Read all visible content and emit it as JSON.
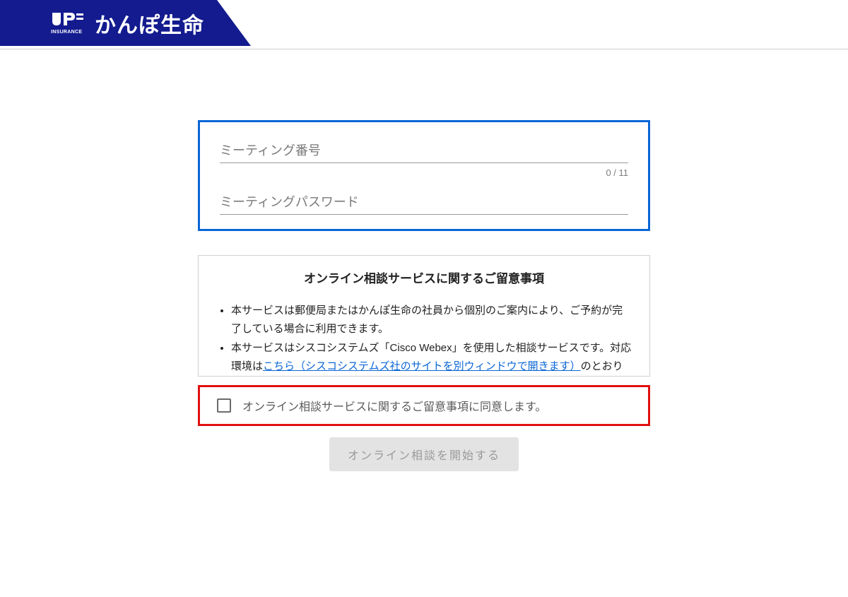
{
  "header": {
    "brand_name": "かんぽ生命",
    "jp_sub": "INSURANCE"
  },
  "form": {
    "meeting_number_placeholder": "ミーティング番号",
    "meeting_number_counter": "0 / 11",
    "meeting_password_placeholder": "ミーティングパスワード"
  },
  "notice": {
    "title": "オンライン相談サービスに関するご留意事項",
    "items": {
      "0": "本サービスは郵便局またはかんぽ生命の社員から個別のご案内により、ご予約が完了している場合に利用できます。",
      "1_pre": "本サービスはシスコシステムズ「Cisco Webex」を使用した相談サービスです。対応環境は",
      "1_link": "こちら（シスコシステムズ社のサイトを別ウィンドウで開きます）",
      "1_post": "のとおりです。"
    }
  },
  "consent": {
    "label": "オンライン相談サービスに関するご留意事項に同意します。"
  },
  "button": {
    "start": "オンライン相談を開始する"
  }
}
